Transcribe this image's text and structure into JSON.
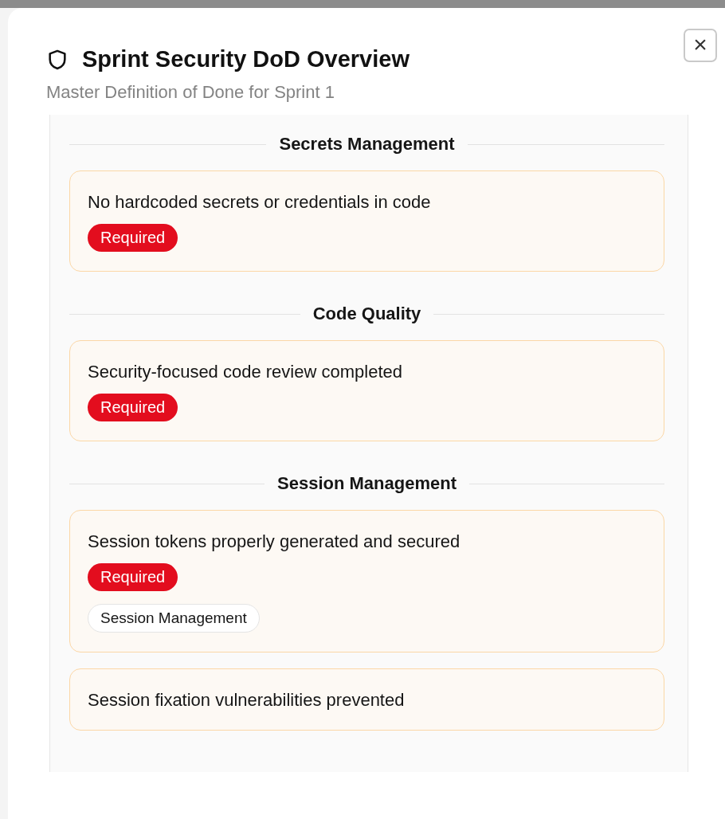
{
  "dialog": {
    "title": "Sprint Security DoD Overview",
    "subtitle": "Master Definition of Done for Sprint 1",
    "close_label": "×"
  },
  "sections": [
    {
      "title": "Secrets Management",
      "items": [
        {
          "text": "No hardcoded secrets or credentials in code",
          "badge": {
            "label": "Required",
            "kind": "required"
          }
        }
      ]
    },
    {
      "title": "Code Quality",
      "items": [
        {
          "text": "Security-focused code review completed",
          "badge": {
            "label": "Required",
            "kind": "required"
          }
        }
      ]
    },
    {
      "title": "Session Management",
      "items": [
        {
          "text": "Session tokens properly generated and secured",
          "badge": {
            "label": "Required",
            "kind": "required"
          },
          "tags": [
            "Session Management"
          ]
        },
        {
          "text": "Session fixation vulnerabilities prevented"
        }
      ]
    }
  ]
}
